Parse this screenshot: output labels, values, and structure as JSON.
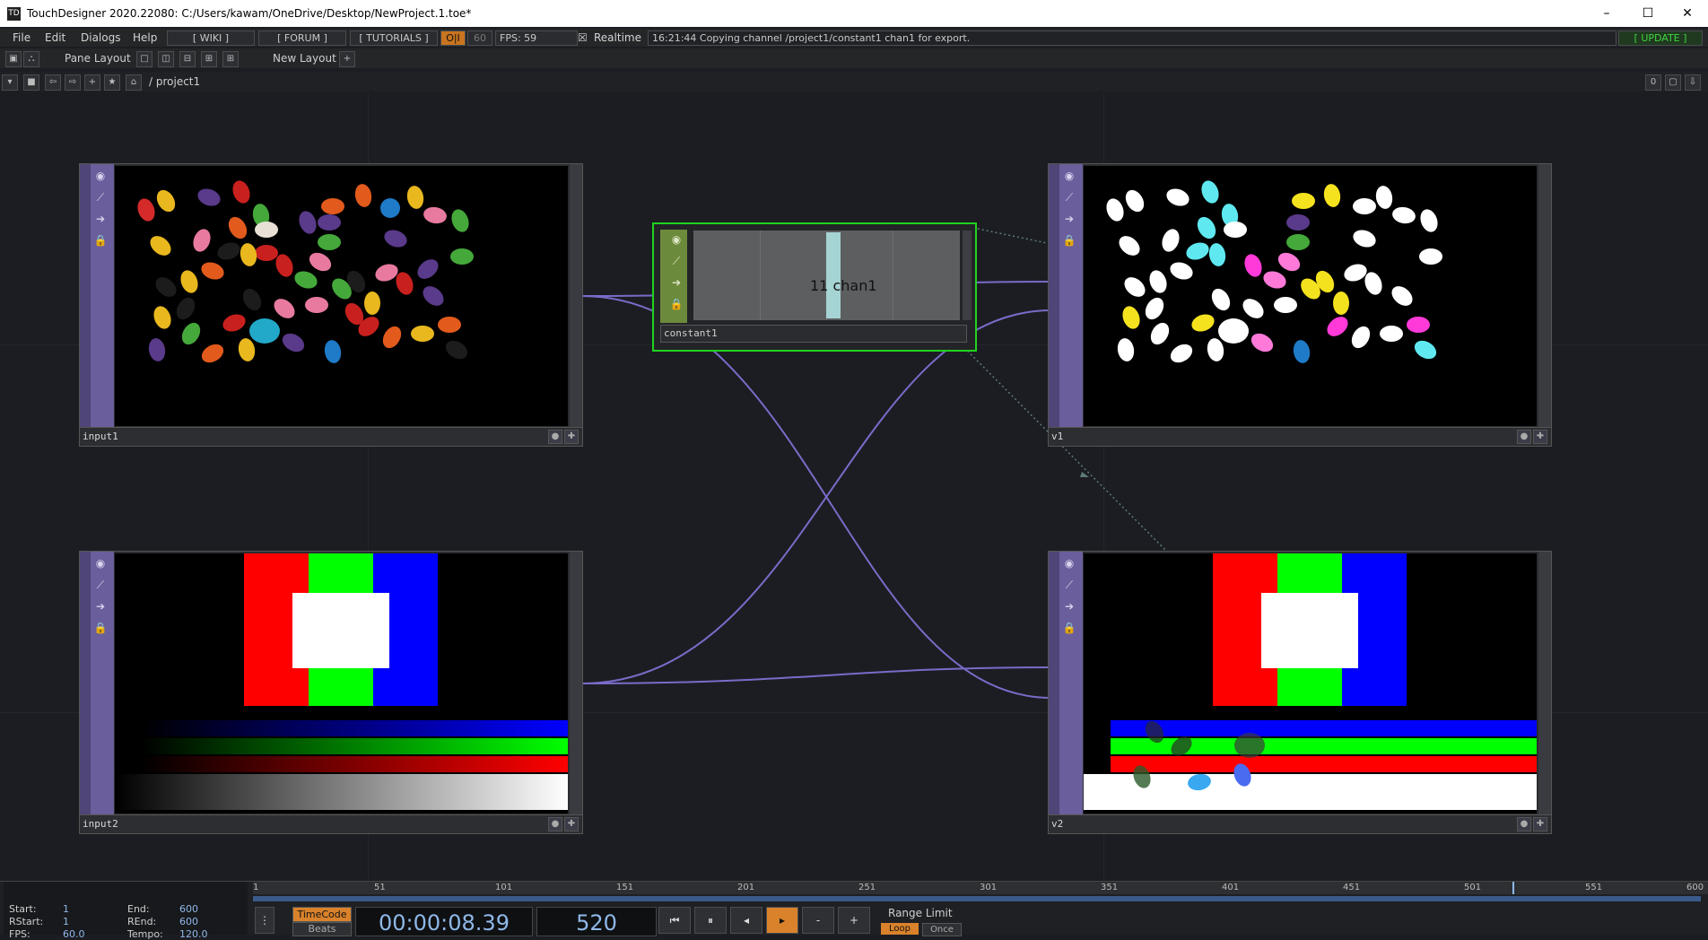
{
  "window": {
    "app_icon": "TD",
    "title": "TouchDesigner 2020.22080: C:/Users/kawam/OneDrive/Desktop/NewProject.1.toe*",
    "minimize": "–",
    "maximize": "☐",
    "close": "✕"
  },
  "menu": {
    "items": [
      "File",
      "Edit",
      "Dialogs",
      "Help"
    ],
    "wiki": "[ WIKI ]",
    "forum": "[ FORUM ]",
    "tutorials": "[ TUTORIALS ]",
    "oi": "O|I",
    "fps_cap": "60",
    "fps": "FPS:  59",
    "realtime_check": "☒",
    "realtime": "Realtime",
    "status": "16:21:44 Copying channel /project1/constant1 chan1 for export.",
    "update": "[ UPDATE ]"
  },
  "toolbar": {
    "pane_layout": "Pane Layout",
    "new_layout": "New Layout",
    "add": "+"
  },
  "pathbar": {
    "path": "/ project1",
    "counter": "0"
  },
  "nodes": {
    "input1": {
      "label": "input1"
    },
    "input2": {
      "label": "input2"
    },
    "v1": {
      "label": "v1"
    },
    "v2": {
      "label": "v2"
    },
    "constant1": {
      "label": "constant1",
      "value_text": "11 chan1"
    }
  },
  "timeline": {
    "ticks": [
      "1",
      "51",
      "101",
      "151",
      "201",
      "251",
      "301",
      "351",
      "401",
      "451",
      "501",
      "551",
      "600"
    ]
  },
  "bottom": {
    "start_label": "Start:",
    "start": "1",
    "end_label": "End:",
    "end": "600",
    "rstart_label": "RStart:",
    "rstart": "1",
    "rend_label": "REnd:",
    "rend": "600",
    "fps_label": "FPS:",
    "fps": "60.0",
    "tempo_label": "Tempo:",
    "tempo": "120.0",
    "timecode_btn": "TimeCode",
    "beats_btn": "Beats",
    "timecode": "00:00:08.39",
    "frame": "520",
    "range_limit": "Range Limit",
    "loop": "Loop",
    "once": "Once"
  },
  "colors": {
    "wire": "#7a6bc9",
    "comp_side": "#6b5e9c",
    "chop_border": "#1ed41e",
    "accent_orange": "#d9822b"
  }
}
